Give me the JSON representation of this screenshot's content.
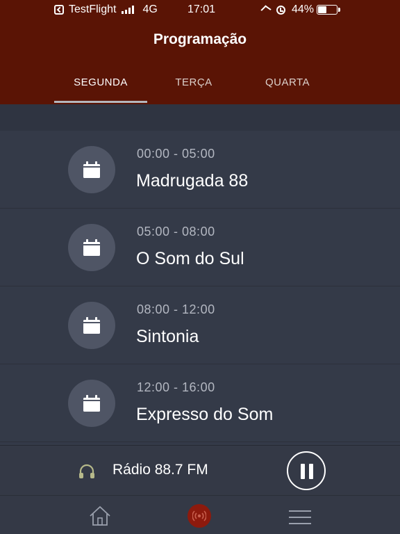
{
  "status_bar": {
    "carrier": "TestFlight",
    "network": "4G",
    "time": "17:01",
    "battery": "44%",
    "battery_level": 0.44
  },
  "header": {
    "title": "Programação",
    "tabs": [
      {
        "label": "SEGUNDA",
        "active": true
      },
      {
        "label": "TERÇA",
        "active": false
      },
      {
        "label": "QUARTA",
        "active": false
      }
    ]
  },
  "schedule": [
    {
      "time": "00:00 - 05:00",
      "name": "Madrugada 88",
      "icon": "calendar-icon"
    },
    {
      "time": "05:00 - 08:00",
      "name": "O Som do Sul",
      "icon": "calendar-icon"
    },
    {
      "time": "08:00 - 12:00",
      "name": "Sintonia",
      "icon": "calendar-icon"
    },
    {
      "time": "12:00 - 16:00",
      "name": "Expresso do Som",
      "icon": "calendar-icon"
    }
  ],
  "player": {
    "station": "Rádio 88.7 FM",
    "state": "playing",
    "icon": "headphones-icon",
    "control_icon": "pause-icon"
  },
  "bottom_nav": {
    "items": [
      {
        "icon": "home-icon"
      },
      {
        "icon": "radio-broadcast-icon",
        "active": true
      },
      {
        "icon": "menu-icon"
      }
    ]
  },
  "colors": {
    "header_bg": "#5a1405",
    "list_bg": "#343a48",
    "accent": "#8d1a0d"
  }
}
